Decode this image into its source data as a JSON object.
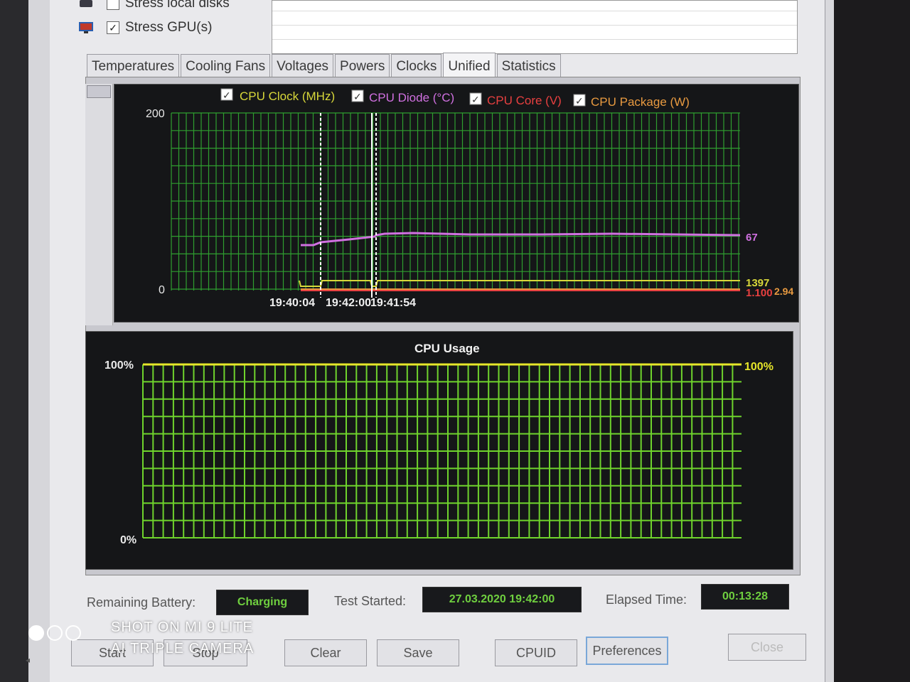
{
  "options": [
    {
      "label": "Stress local disks",
      "checked": false
    },
    {
      "label": "Stress GPU(s)",
      "checked": true
    }
  ],
  "tabs": [
    {
      "label": "Temperatures",
      "active": false
    },
    {
      "label": "Cooling Fans",
      "active": false
    },
    {
      "label": "Voltages",
      "active": false
    },
    {
      "label": "Powers",
      "active": false
    },
    {
      "label": "Clocks",
      "active": false
    },
    {
      "label": "Unified",
      "active": true
    },
    {
      "label": "Statistics",
      "active": false
    }
  ],
  "unified_chart": {
    "legend": [
      {
        "label": "CPU Clock (MHz)",
        "color": "#d8d83a",
        "checked": true
      },
      {
        "label": "CPU Diode (°C)",
        "color": "#d070e0",
        "checked": true
      },
      {
        "label": "CPU Core (V)",
        "color": "#e84040",
        "checked": true
      },
      {
        "label": "CPU Package (W)",
        "color": "#e89a40",
        "checked": true
      }
    ],
    "y_max_label": "200",
    "y_min_label": "0",
    "time_labels": [
      "19:40:04",
      "19:42:00",
      "19:41:54"
    ],
    "readouts": {
      "diode": "67",
      "clock": "1397",
      "core": "1.100",
      "package": "2.94"
    },
    "colors": {
      "grid": "#2f9e2f",
      "bg": "#151618",
      "marker": "#ffffff"
    }
  },
  "usage_chart": {
    "title": "CPU Usage",
    "y_max_label": "100%",
    "y_min_label": "0%",
    "readout": "100%",
    "value_percent": 100,
    "colors": {
      "grid": "#6fd32c",
      "line": "#e6e62a"
    }
  },
  "status": {
    "battery_label": "Remaining Battery:",
    "battery_value": "Charging",
    "started_label": "Test Started:",
    "started_value": "27.03.2020 19:42:00",
    "elapsed_label": "Elapsed Time:",
    "elapsed_value": "00:13:28"
  },
  "buttons": {
    "start": "Start",
    "stop": "Stop",
    "clear": "Clear",
    "save": "Save",
    "cpuid": "CPUID",
    "preferences": "Preferences",
    "close": "Close"
  },
  "watermark": {
    "line1": "SHOT ON MI 9 LITE",
    "line2": "AI TRIPLE CAMERA"
  }
}
